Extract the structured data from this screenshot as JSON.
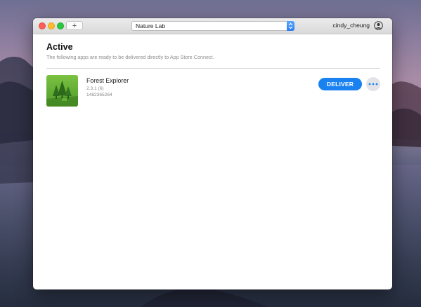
{
  "window": {
    "add_button_label": "+",
    "team_selector_value": "Nature Lab",
    "user_name": "cindy_cheung"
  },
  "section": {
    "title": "Active",
    "subtitle": "The following apps are ready to be delivered directly to App Store Connect."
  },
  "apps": [
    {
      "name": "Forest Explorer",
      "version": "2.3.1 (6)",
      "app_id": "1482365264",
      "deliver_label": "DELIVER",
      "icon": "forest-trees-icon"
    }
  ],
  "colors": {
    "accent": "#1a82f0",
    "icon_green": "#5fae32"
  }
}
